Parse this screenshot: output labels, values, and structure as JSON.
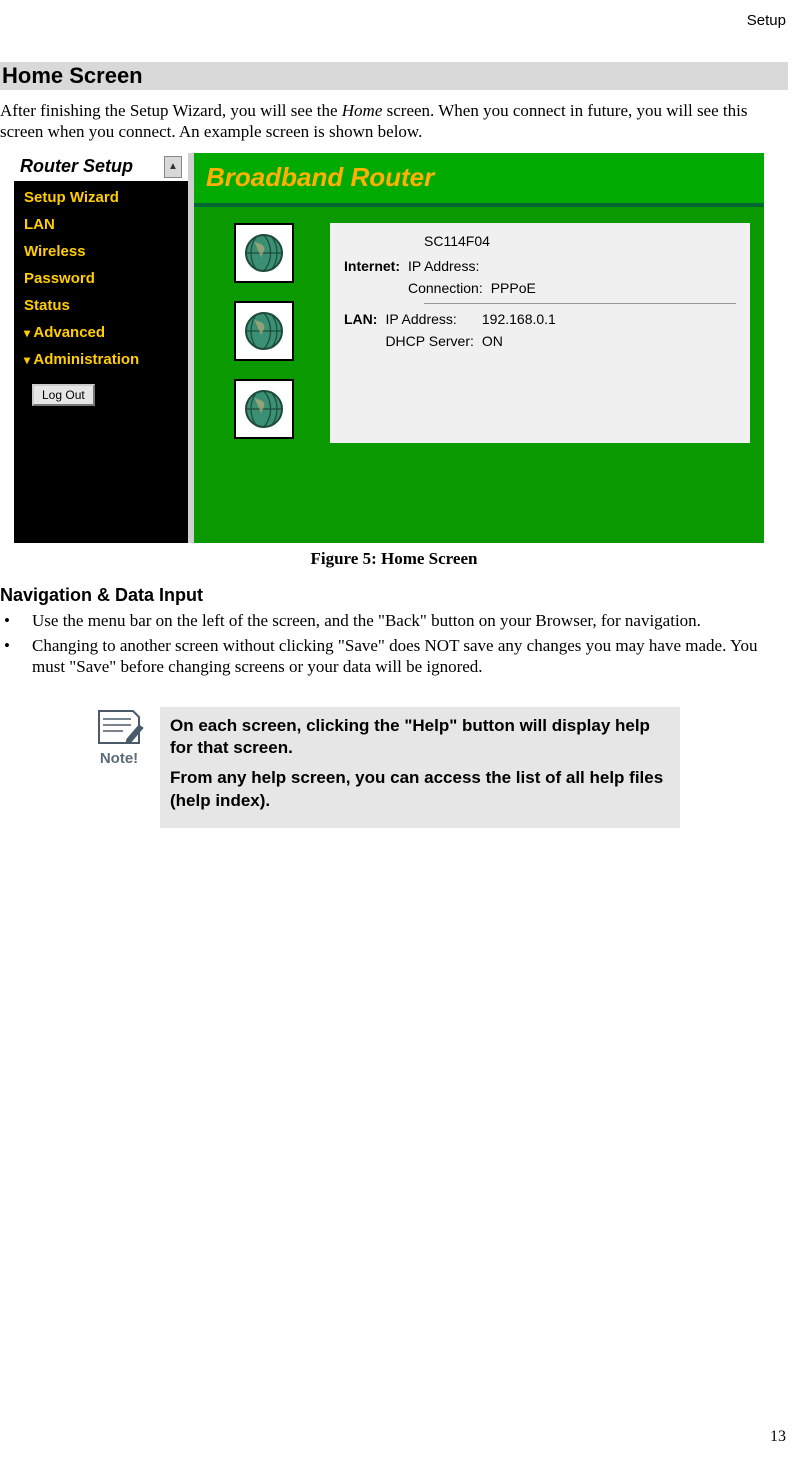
{
  "header": {
    "section": "Setup"
  },
  "footer": {
    "page": "13"
  },
  "h2": "Home Screen",
  "intro_a": "After finishing the Setup Wizard, you will see the ",
  "intro_home": "Home",
  "intro_b": " screen. When you connect in future, you will see this screen when you connect. An example screen is shown below.",
  "screenshot": {
    "sidebar_title": "Router Setup",
    "links": [
      "Setup Wizard",
      "LAN",
      "Wireless",
      "Password",
      "Status",
      "Advanced",
      "Administration"
    ],
    "expandable": [
      false,
      false,
      false,
      false,
      false,
      true,
      true
    ],
    "logout": "Log Out",
    "banner": "Broadband Router",
    "model": "SC114F04",
    "internet_label": "Internet:",
    "internet_ip_label": "IP Address:",
    "internet_ip_value": "",
    "internet_conn_label": "Connection:",
    "internet_conn_value": "PPPoE",
    "lan_label": "LAN:",
    "lan_ip_label": "IP Address:",
    "lan_ip_value": "192.168.0.1",
    "lan_dhcp_label": "DHCP Server:",
    "lan_dhcp_value": "ON"
  },
  "figure_caption": "Figure 5: Home Screen",
  "h3": "Navigation & Data Input",
  "bullets": [
    "Use the menu bar on the left of the screen, and the \"Back\" button on your Browser, for navigation.",
    "Changing to another screen without clicking \"Save\" does NOT save any changes you may have made. You must \"Save\" before changing screens or your data will be ignored."
  ],
  "note_label": "Note!",
  "note_p1": "On each screen, clicking the \"Help\" button will display help for that screen.",
  "note_p2": "From any help screen, you can access the list of all help files (help index)."
}
